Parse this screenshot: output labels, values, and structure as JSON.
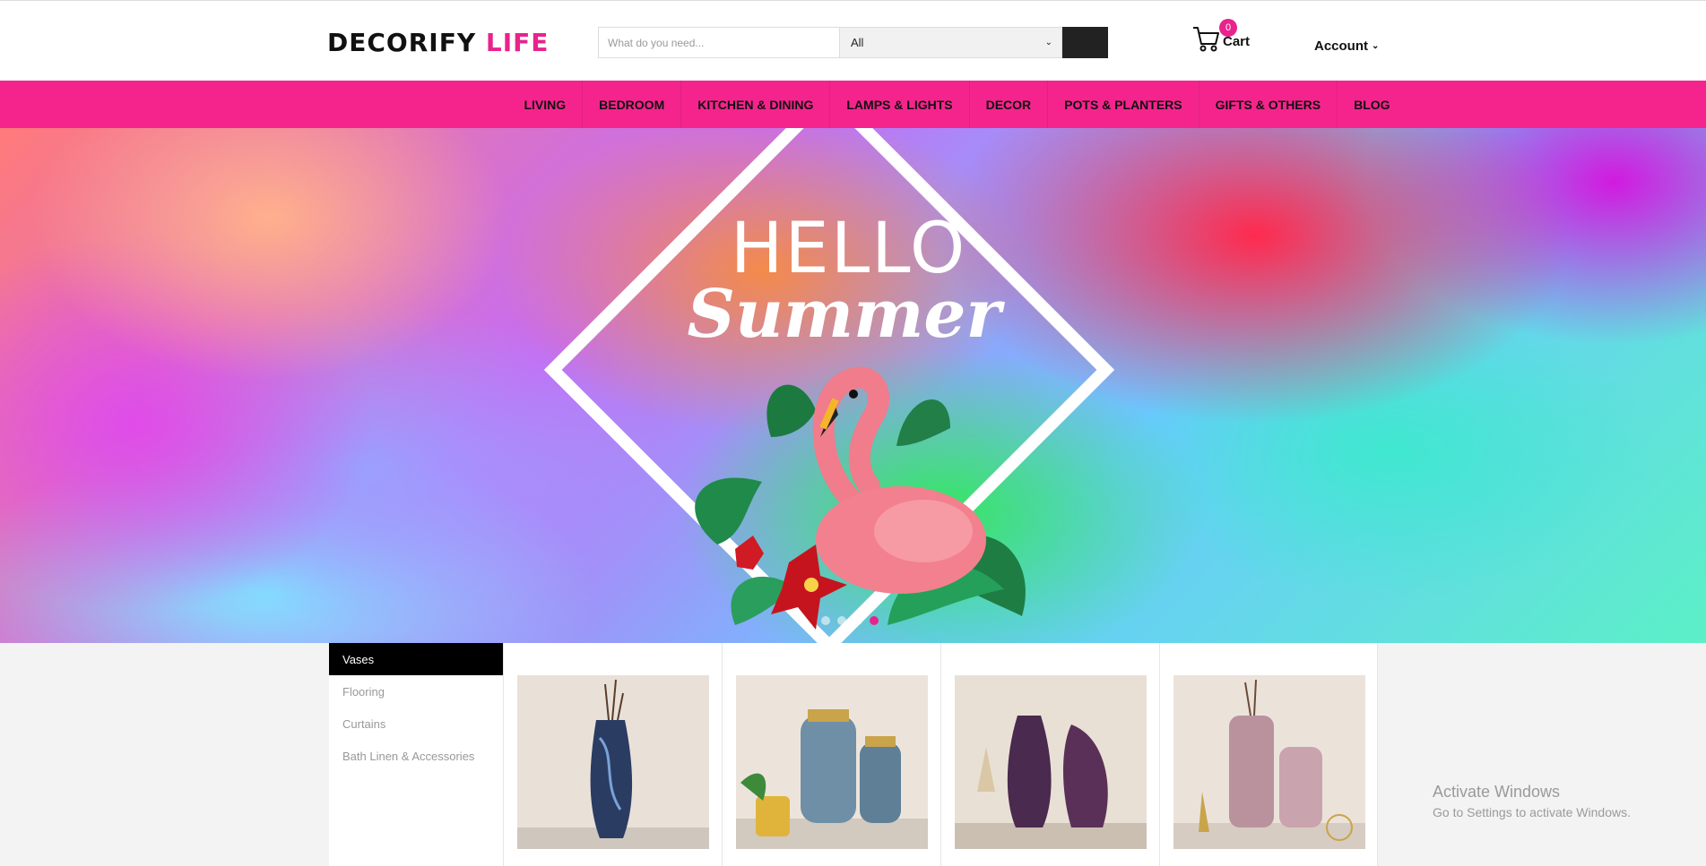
{
  "header": {
    "logo_main": "DECORIFY ",
    "logo_accent": "LIFE",
    "search_placeholder": "What do you need...",
    "category_selected": "All",
    "cart_count": "0",
    "cart_label": "Cart",
    "account_label": "Account"
  },
  "nav": {
    "items": [
      "LIVING",
      "BEDROOM",
      "KITCHEN & DINING",
      "LAMPS & LIGHTS",
      "DECOR",
      "POTS & PLANTERS",
      "GIFTS & OTHERS",
      "BLOG"
    ]
  },
  "hero": {
    "line1": "HELLO",
    "line2": "Summer",
    "slides": 4,
    "active_slide": 4
  },
  "categories": [
    "Vases",
    "Flooring",
    "Curtains",
    "Bath Linen & Accessories"
  ],
  "products": [
    {
      "icon": "blue-swirl-vase"
    },
    {
      "icon": "blue-textured-jars"
    },
    {
      "icon": "purple-glass-vases"
    },
    {
      "icon": "pink-glass-vases"
    }
  ],
  "watermark": {
    "line1": "Activate Windows",
    "line2": "Go to Settings to activate Windows."
  },
  "colors": {
    "brand_pink": "#f5248d",
    "accent_pink": "#e8238c"
  }
}
